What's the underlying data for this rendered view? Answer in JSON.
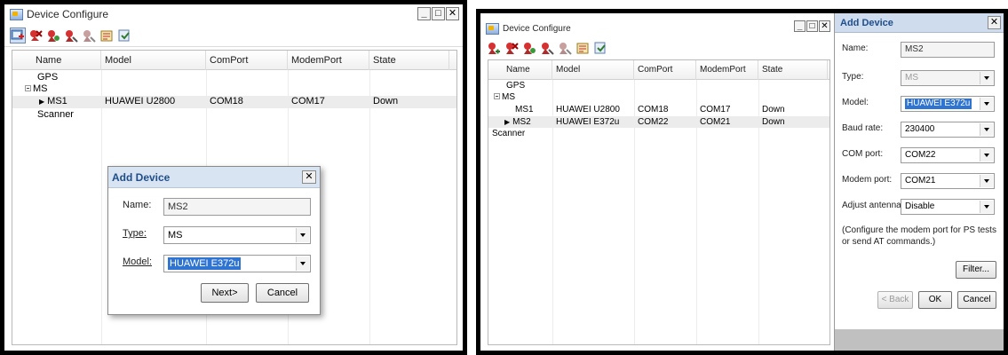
{
  "left": {
    "window_title": "Device Configure",
    "window_buttons": [
      "_",
      "□",
      "✕"
    ],
    "toolbar_icons": [
      "add-device-icon",
      "delete-device-icon",
      "device-properties-icon",
      "device-connect-icon",
      "device-disconnect-icon",
      "export-icon",
      "import-icon"
    ],
    "columns": [
      "Name",
      "Model",
      "ComPort",
      "ModemPort",
      "State"
    ],
    "rows": [
      {
        "name": "GPS",
        "model": "",
        "comport": "",
        "modemport": "",
        "state": "",
        "level": 0
      },
      {
        "name": "MS",
        "model": "",
        "comport": "",
        "modemport": "",
        "state": "",
        "level": 0
      },
      {
        "name": "MS1",
        "model": "HUAWEI U2800",
        "comport": "COM18",
        "modemport": "COM17",
        "state": "Down",
        "level": 1
      },
      {
        "name": "Scanner",
        "model": "",
        "comport": "",
        "modemport": "",
        "state": "",
        "level": 0
      }
    ],
    "dialog": {
      "title": "Add Device",
      "close": "✕",
      "name_label": "Name:",
      "name_value": "MS2",
      "type_label": "Type:",
      "type_value": "MS",
      "model_label": "Model:",
      "model_value": "HUAWEI E372u",
      "next_button": "Next>",
      "cancel_button": "Cancel"
    }
  },
  "right": {
    "window_title": "Device Configure",
    "window_buttons": [
      "_",
      "□",
      "✕"
    ],
    "columns": [
      "Name",
      "Model",
      "ComPort",
      "ModemPort",
      "State"
    ],
    "rows": [
      {
        "name": "GPS",
        "model": "",
        "comport": "",
        "modemport": "",
        "state": ""
      },
      {
        "name": "MS",
        "model": "",
        "comport": "",
        "modemport": "",
        "state": ""
      },
      {
        "name": "MS1",
        "model": "HUAWEI U2800",
        "comport": "COM18",
        "modemport": "COM17",
        "state": "Down"
      },
      {
        "name": "MS2",
        "model": "HUAWEI E372u",
        "comport": "COM22",
        "modemport": "COM21",
        "state": "Down"
      },
      {
        "name": "Scanner",
        "model": "",
        "comport": "",
        "modemport": "",
        "state": ""
      }
    ],
    "panel": {
      "title": "Add Device",
      "close": "✕",
      "name_label": "Name:",
      "name_value": "MS2",
      "type_label": "Type:",
      "type_value": "MS",
      "model_label": "Model:",
      "model_value": "HUAWEI E372u",
      "baud_label": "Baud rate:",
      "baud_value": "230400",
      "com_label": "COM port:",
      "com_value": "COM22",
      "modem_label": "Modem port:",
      "modem_value": "COM21",
      "antenna_label": "Adjust antenna:",
      "antenna_value": "Disable",
      "note": "(Configure the modem port for PS tests or send AT commands.)",
      "filter_button": "Filter...",
      "back_button": "< Back",
      "ok_button": "OK",
      "cancel_button": "Cancel"
    }
  },
  "colors": {
    "selection": "#2f74d0",
    "dialog_title_bg": "#d9e4f2",
    "dialog_title_text": "#1f4e8c",
    "selected_row": "#ececec"
  }
}
